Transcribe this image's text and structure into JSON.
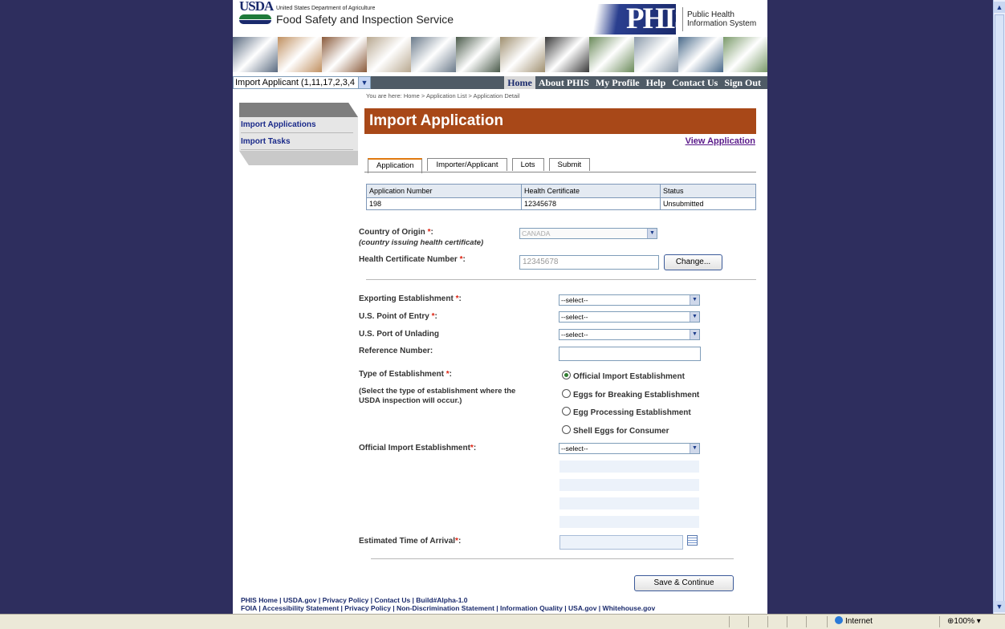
{
  "header": {
    "dept": "United States Department of Agriculture",
    "agency": "Food Safety and Inspection Service",
    "usda_logo_text": "USDA",
    "phis_logo_text": "PHIS",
    "phis_subtitle": "Public Health Information System"
  },
  "photo_colors": [
    "#5a6a80",
    "#c09060",
    "#8a5a3a",
    "#b8a890",
    "#6a7a8a",
    "#4a5a4a",
    "#a09070",
    "#3a3a3a",
    "#6a8a5a",
    "#8a9aaa",
    "#4a6a8a",
    "#7a9a6a"
  ],
  "navbar": {
    "role_value": "Import Applicant (1,11,17,2,3,4",
    "links": [
      "Home",
      "About PHIS",
      "My Profile",
      "Help",
      "Contact Us",
      "Sign Out"
    ]
  },
  "breadcrumb": "You are here: Home > Application List > Application Detail",
  "sidebar": {
    "items": [
      "Import Applications",
      "Import Tasks"
    ]
  },
  "page": {
    "title": "Import Application",
    "view_link": "View Application"
  },
  "tabs": [
    "Application",
    "Importer/Applicant",
    "Lots",
    "Submit"
  ],
  "summary": {
    "headers": [
      "Application Number",
      "Health Certificate",
      "Status"
    ],
    "row": [
      "198",
      "12345678",
      "Unsubmitted"
    ]
  },
  "form": {
    "country_label": "Country of Origin",
    "country_hint": "(country issuing health certificate)",
    "country_value": "CANADA",
    "hc_label": "Health Certificate Number",
    "hc_value": "12345678",
    "change_button": "Change...",
    "exporting_label": "Exporting Establishment",
    "entry_label": "U.S. Point of Entry",
    "port_label": "U.S. Port of Unlading",
    "select_placeholder": "--select--",
    "reference_label": "Reference Number:",
    "reference_value": "",
    "type_label": "Type of Establishment",
    "type_hint": "(Select the type of establishment where the USDA inspection will occur.)",
    "type_options": [
      "Official Import Establishment",
      "Eggs for Breaking Establishment",
      "Egg Processing Establishment",
      "Shell Eggs for Consumer"
    ],
    "official_label": "Official Import Establishment",
    "eta_label": "Estimated Time of Arrival",
    "eta_value": "",
    "save_button": "Save & Continue"
  },
  "footer": {
    "line1": "PHIS Home | USDA.gov | Privacy Policy | Contact Us | Build#Alpha-1.0",
    "line2": "FOIA | Accessibility Statement | Privacy Policy | Non-Discrimination Statement | Information Quality | USA.gov | Whitehouse.gov"
  },
  "statusbar": {
    "zone": "Internet",
    "zoom": "100%"
  }
}
